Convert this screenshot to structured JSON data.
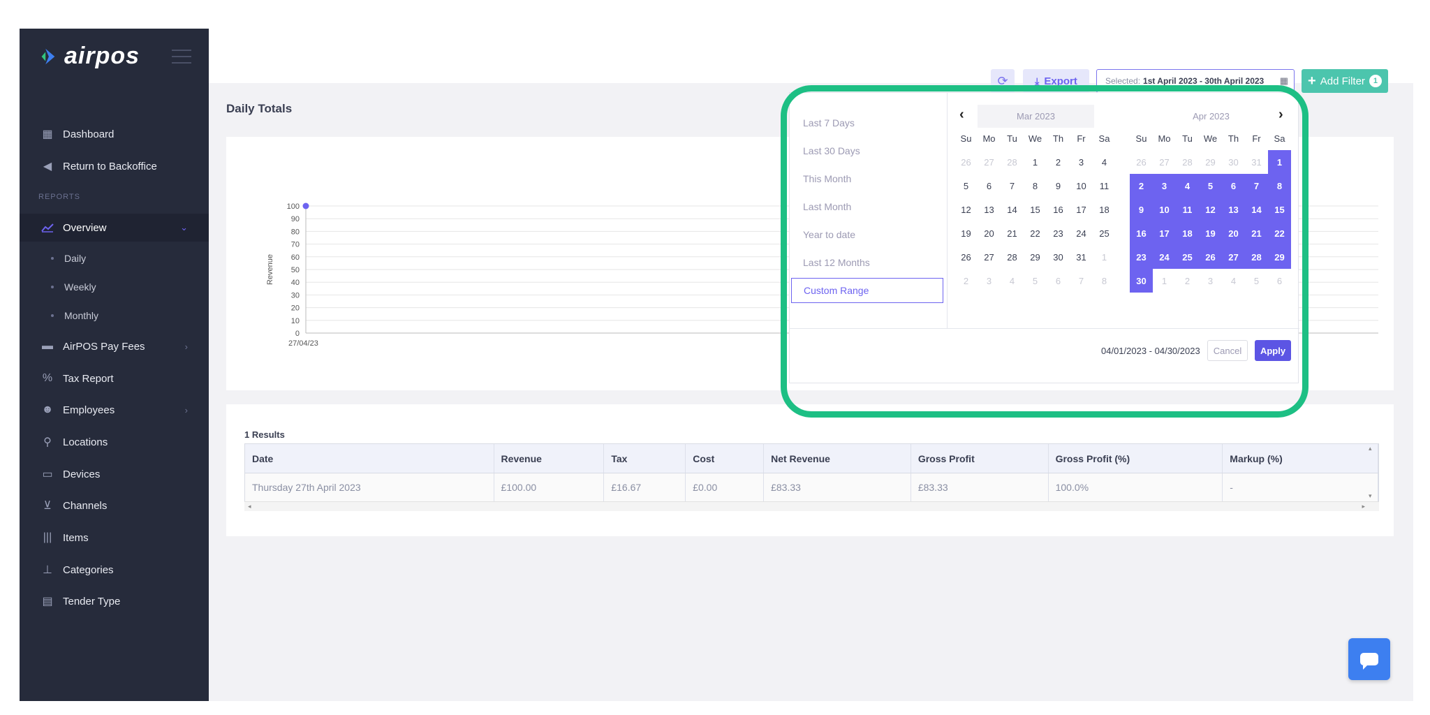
{
  "app": {
    "logo_text": "airpos",
    "header": {
      "page_title": "Daily Totals"
    }
  },
  "sidebar": {
    "top_items": [
      {
        "label": "Dashboard",
        "icon": "calendar-grid-icon"
      },
      {
        "label": "Return to Backoffice",
        "icon": "reply-arrow-icon"
      }
    ],
    "section_label": "REPORTS",
    "overview": {
      "label": "Overview",
      "icon": "line-chart-icon"
    },
    "sub_items": [
      "Daily",
      "Weekly",
      "Monthly"
    ],
    "items": [
      {
        "label": "AirPOS Pay Fees",
        "icon": "card-icon",
        "has_submenu": true
      },
      {
        "label": "Tax Report",
        "icon": "percent-icon",
        "has_submenu": false
      },
      {
        "label": "Employees",
        "icon": "users-icon",
        "has_submenu": true
      },
      {
        "label": "Locations",
        "icon": "location-pin-icon",
        "has_submenu": false
      },
      {
        "label": "Devices",
        "icon": "tablet-icon",
        "has_submenu": false
      },
      {
        "label": "Channels",
        "icon": "cart-icon",
        "has_submenu": false
      },
      {
        "label": "Items",
        "icon": "barcode-icon",
        "has_submenu": false
      },
      {
        "label": "Categories",
        "icon": "hierarchy-icon",
        "has_submenu": false
      },
      {
        "label": "Tender Type",
        "icon": "credit-card-icon",
        "has_submenu": false
      }
    ]
  },
  "toolbar": {
    "export_label": "Export",
    "selected_label": "Selected:",
    "selected_value": "1st April 2023 - 30th April 2023",
    "add_filter_label": "Add Filter",
    "filter_count": "1"
  },
  "chart_data": {
    "type": "line",
    "ylabel": "Revenue",
    "yticks": [
      0,
      10,
      20,
      30,
      40,
      50,
      60,
      70,
      80,
      90,
      100
    ],
    "x": [
      "27/04/23"
    ],
    "series": [
      {
        "values": [
          100
        ]
      }
    ],
    "ylim": [
      0,
      100
    ],
    "grid": true,
    "accent": "#6d63f0"
  },
  "picker": {
    "ranges": [
      "Last 7 Days",
      "Last 30 Days",
      "This Month",
      "Last Month",
      "Year to date",
      "Last 12 Months",
      "Custom Range"
    ],
    "selected_range": "Custom Range",
    "left_month": "Mar 2023",
    "right_month": "Apr 2023",
    "weekdays": [
      "Su",
      "Mo",
      "Tu",
      "We",
      "Th",
      "Fr",
      "Sa"
    ],
    "left_days": [
      [
        "26",
        "27",
        "28",
        "1",
        "2",
        "3",
        "4"
      ],
      [
        "5",
        "6",
        "7",
        "8",
        "9",
        "10",
        "11"
      ],
      [
        "12",
        "13",
        "14",
        "15",
        "16",
        "17",
        "18"
      ],
      [
        "19",
        "20",
        "21",
        "22",
        "23",
        "24",
        "25"
      ],
      [
        "26",
        "27",
        "28",
        "29",
        "30",
        "31",
        "1"
      ],
      [
        "2",
        "3",
        "4",
        "5",
        "6",
        "7",
        "8"
      ]
    ],
    "right_days": [
      [
        "26",
        "27",
        "28",
        "29",
        "30",
        "31",
        "1"
      ],
      [
        "2",
        "3",
        "4",
        "5",
        "6",
        "7",
        "8"
      ],
      [
        "9",
        "10",
        "11",
        "12",
        "13",
        "14",
        "15"
      ],
      [
        "16",
        "17",
        "18",
        "19",
        "20",
        "21",
        "22"
      ],
      [
        "23",
        "24",
        "25",
        "26",
        "27",
        "28",
        "29"
      ],
      [
        "30",
        "1",
        "2",
        "3",
        "4",
        "5",
        "6"
      ]
    ],
    "range_text": "04/01/2023 - 04/30/2023",
    "cancel_label": "Cancel",
    "apply_label": "Apply"
  },
  "results": {
    "count_label": "1 Results",
    "columns": [
      "Date",
      "Revenue",
      "Tax",
      "Cost",
      "Net Revenue",
      "Gross Profit",
      "Gross Profit (%)",
      "Markup (%)"
    ],
    "rows": [
      [
        "Thursday 27th April 2023",
        "£100.00",
        "£16.67",
        "£0.00",
        "£83.33",
        "£83.33",
        "100.0%",
        "-"
      ]
    ]
  },
  "colors": {
    "sidebar": "#262b3b",
    "accent": "#6d63f0",
    "add_filter": "#4cc5ad",
    "highlight": "#1dbf84"
  }
}
